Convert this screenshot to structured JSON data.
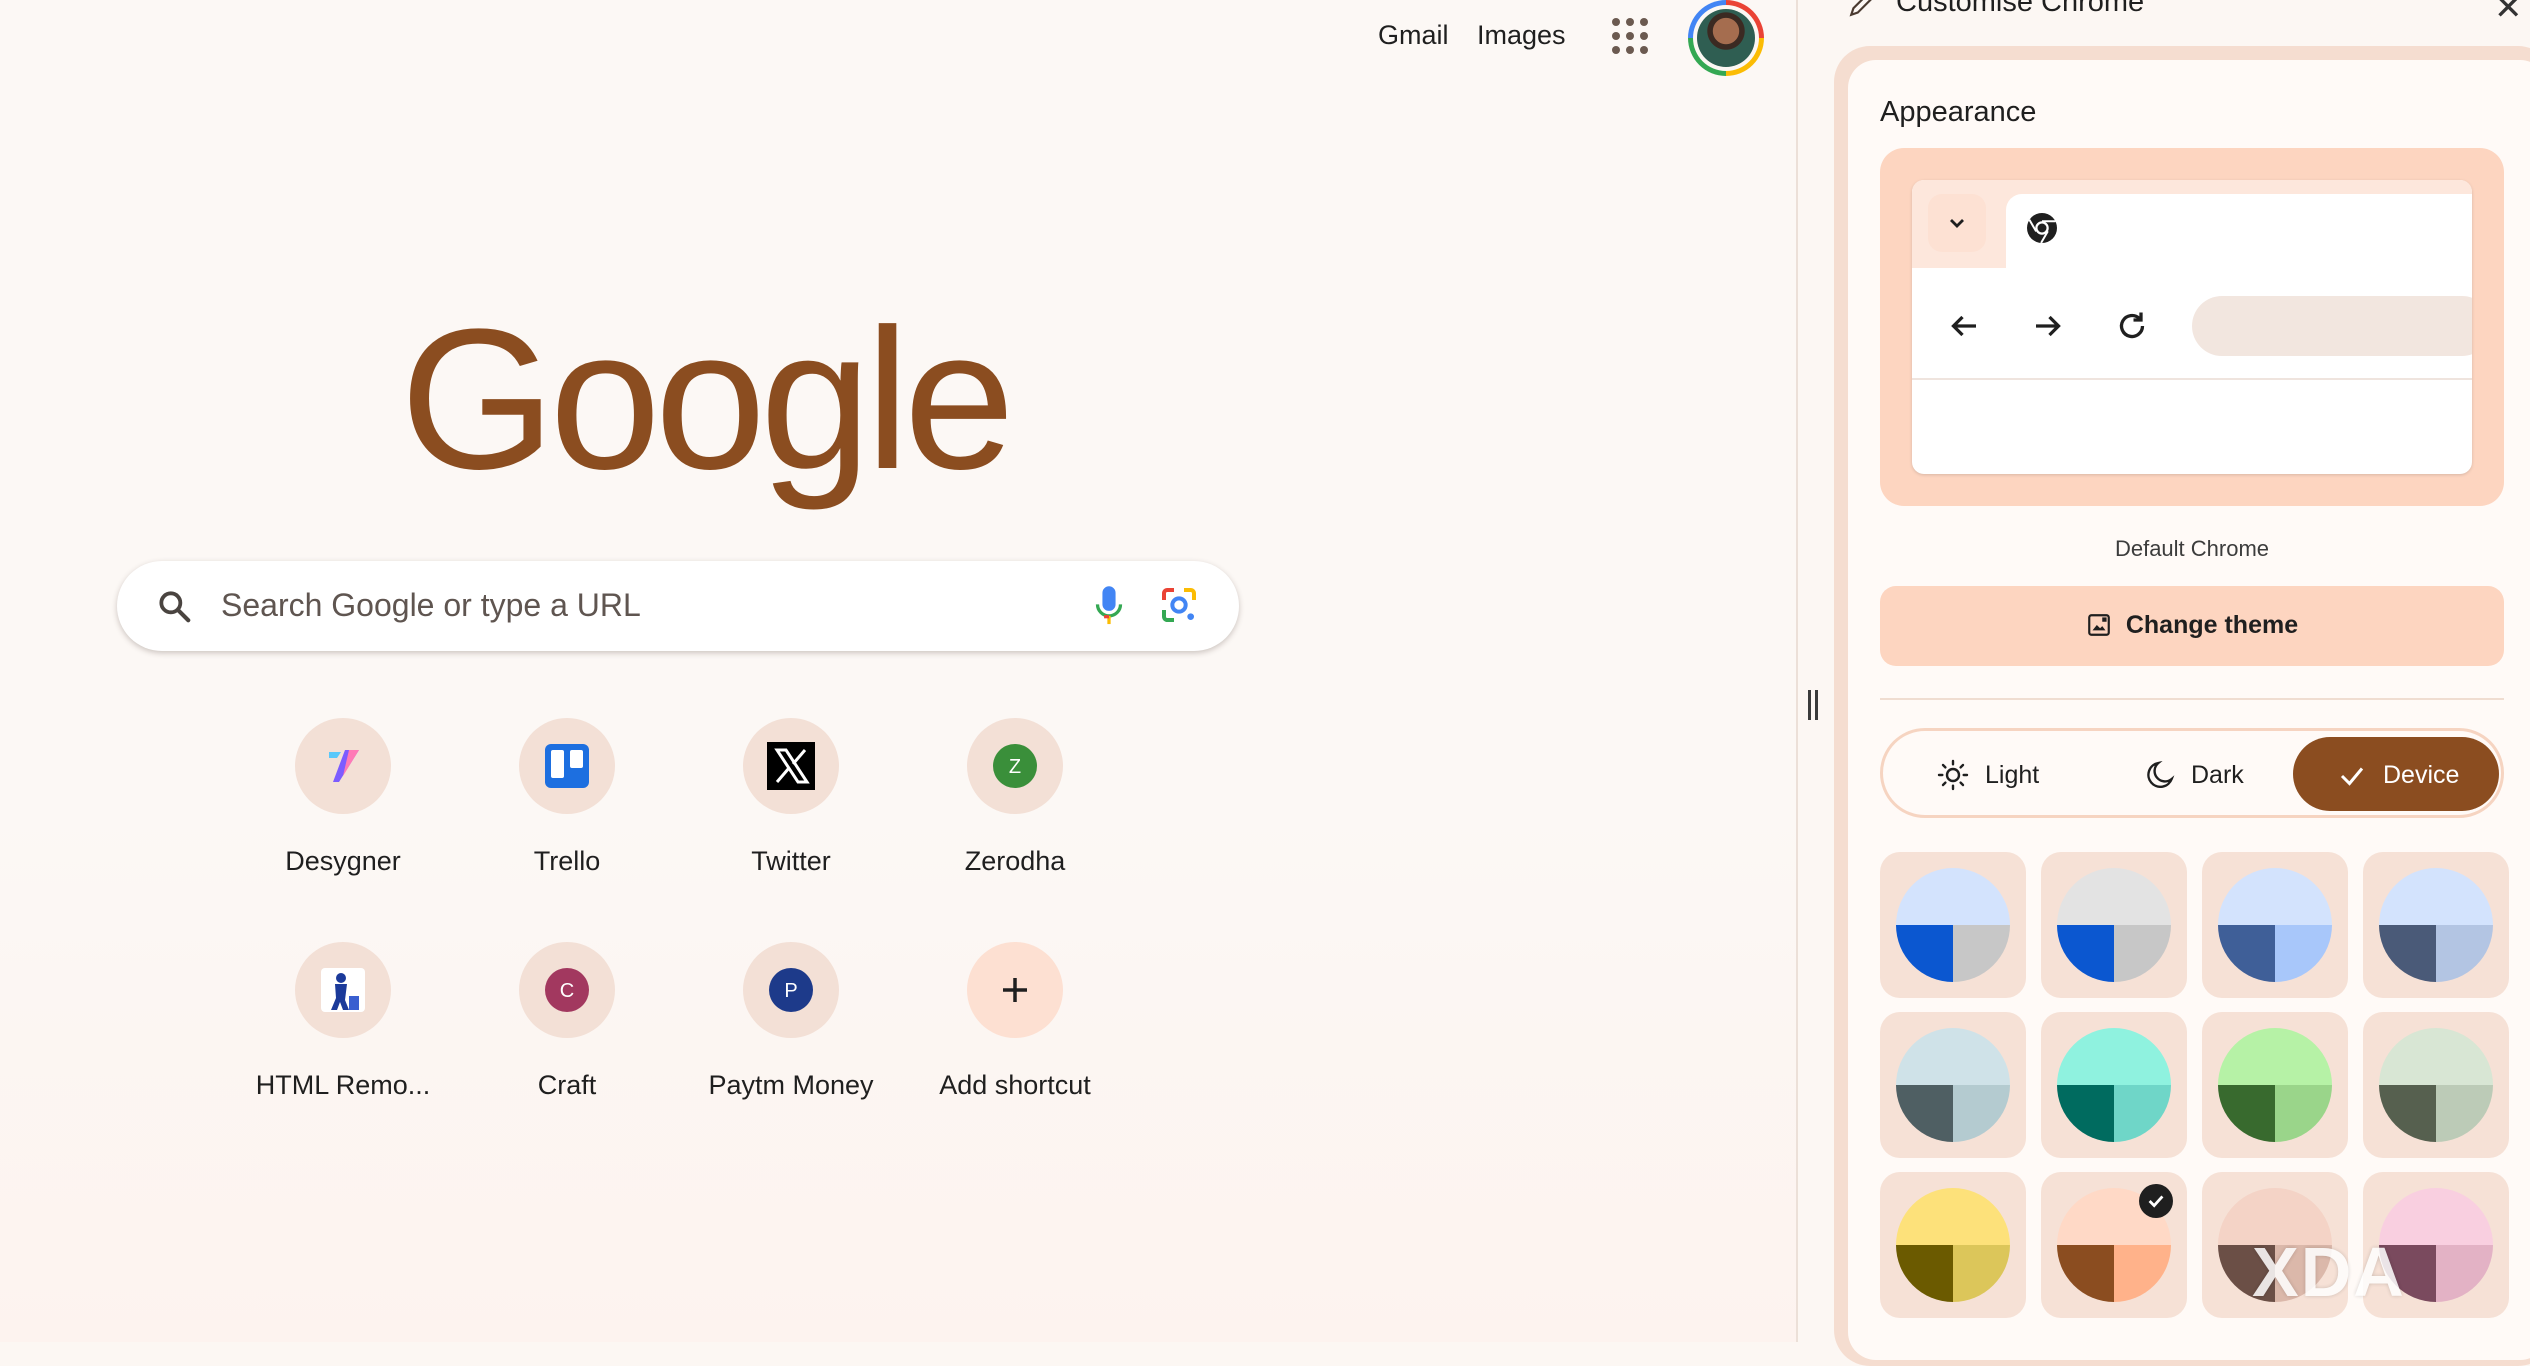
{
  "header": {
    "gmail_label": "Gmail",
    "images_label": "Images"
  },
  "logo": {
    "text": "Google",
    "color": "#8b4d20"
  },
  "search": {
    "placeholder": "Search Google or type a URL"
  },
  "shortcuts": [
    {
      "label": "Desygner",
      "icon": "desygner-icon"
    },
    {
      "label": "Trello",
      "icon": "trello-icon"
    },
    {
      "label": "Twitter",
      "icon": "x-icon"
    },
    {
      "label": "Zerodha",
      "icon": "zerodha-icon",
      "letter": "Z"
    },
    {
      "label": "HTML Remo...",
      "icon": "html-remover-icon"
    },
    {
      "label": "Craft",
      "icon": "craft-icon",
      "letter": "C"
    },
    {
      "label": "Paytm Money",
      "icon": "paytm-money-icon",
      "letter": "P"
    },
    {
      "label": "Add shortcut",
      "icon": "plus-icon",
      "letter": "+"
    }
  ],
  "panel": {
    "title": "Customise Chrome",
    "section_title": "Appearance",
    "theme_name": "Default Chrome",
    "change_theme_label": "Change theme",
    "modes": [
      {
        "label": "Light",
        "icon": "sun-icon",
        "selected": false
      },
      {
        "label": "Dark",
        "icon": "moon-icon",
        "selected": false
      },
      {
        "label": "Device",
        "icon": "check-icon",
        "selected": true
      }
    ],
    "accent_color": "#8b4d20",
    "swatches": [
      {
        "top": "#d3e3fd",
        "bl": "#0b57d0",
        "br": "#c7c7c7",
        "selected": false
      },
      {
        "top": "#e3e3e3",
        "bl": "#0b57d0",
        "br": "#c7c7c7",
        "selected": false
      },
      {
        "top": "#d3e3fd",
        "bl": "#3f5f98",
        "br": "#a8c7fa",
        "selected": false
      },
      {
        "top": "#d3e3fd",
        "bl": "#4a5a78",
        "br": "#b3c5e3",
        "selected": false
      },
      {
        "top": "#cfe2e8",
        "bl": "#4f5f63",
        "br": "#b4cbd0",
        "selected": false
      },
      {
        "top": "#8ff2df",
        "bl": "#006b5f",
        "br": "#6fd6c8",
        "selected": false
      },
      {
        "top": "#b6f2a6",
        "bl": "#386a2e",
        "br": "#9ad58a",
        "selected": false
      },
      {
        "top": "#d8e6d4",
        "bl": "#56604f",
        "br": "#bccbb7",
        "selected": false
      },
      {
        "top": "#fde17a",
        "bl": "#6b5a00",
        "br": "#dcc65a",
        "selected": false
      },
      {
        "top": "#ffd9c6",
        "bl": "#8b4d20",
        "br": "#ffb28a",
        "selected": true
      },
      {
        "top": "#f4d3c6",
        "bl": "#6b4f46",
        "br": "#dbb8aa",
        "selected": false
      },
      {
        "top": "#f9cfe0",
        "bl": "#7a4a5e",
        "br": "#e3b2c5",
        "selected": false
      }
    ]
  },
  "watermark": "XDA"
}
